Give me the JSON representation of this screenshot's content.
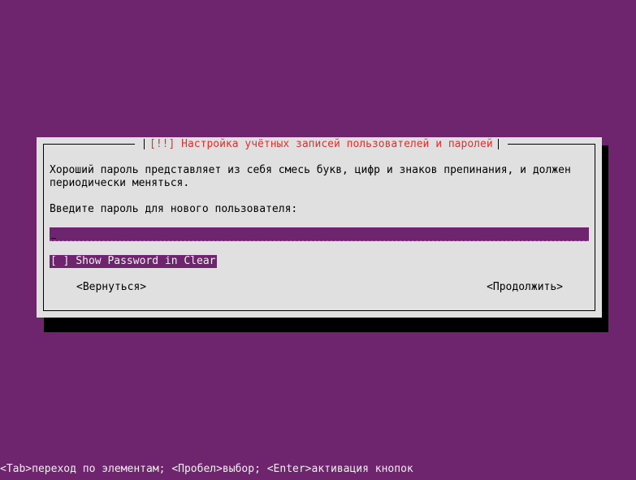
{
  "dialog": {
    "title": "[!!] Настройка учётных записей пользователей и паролей",
    "message": "Хороший пароль представляет из себя смесь букв, цифр и знаков препинания, и должен периодически меняться.",
    "prompt": "Введите пароль для нового пользователя:",
    "password_value": "",
    "checkbox_label": "[ ] Show Password in Clear",
    "back_label": "<Вернуться>",
    "continue_label": "<Продолжить>"
  },
  "statusbar": {
    "text": "<Tab>переход по элементам; <Пробел>выбор; <Enter>активация кнопок"
  },
  "colors": {
    "background": "#6e256e",
    "dialog": "#e0e0e0",
    "title": "#e03030",
    "shadow": "#000000"
  }
}
